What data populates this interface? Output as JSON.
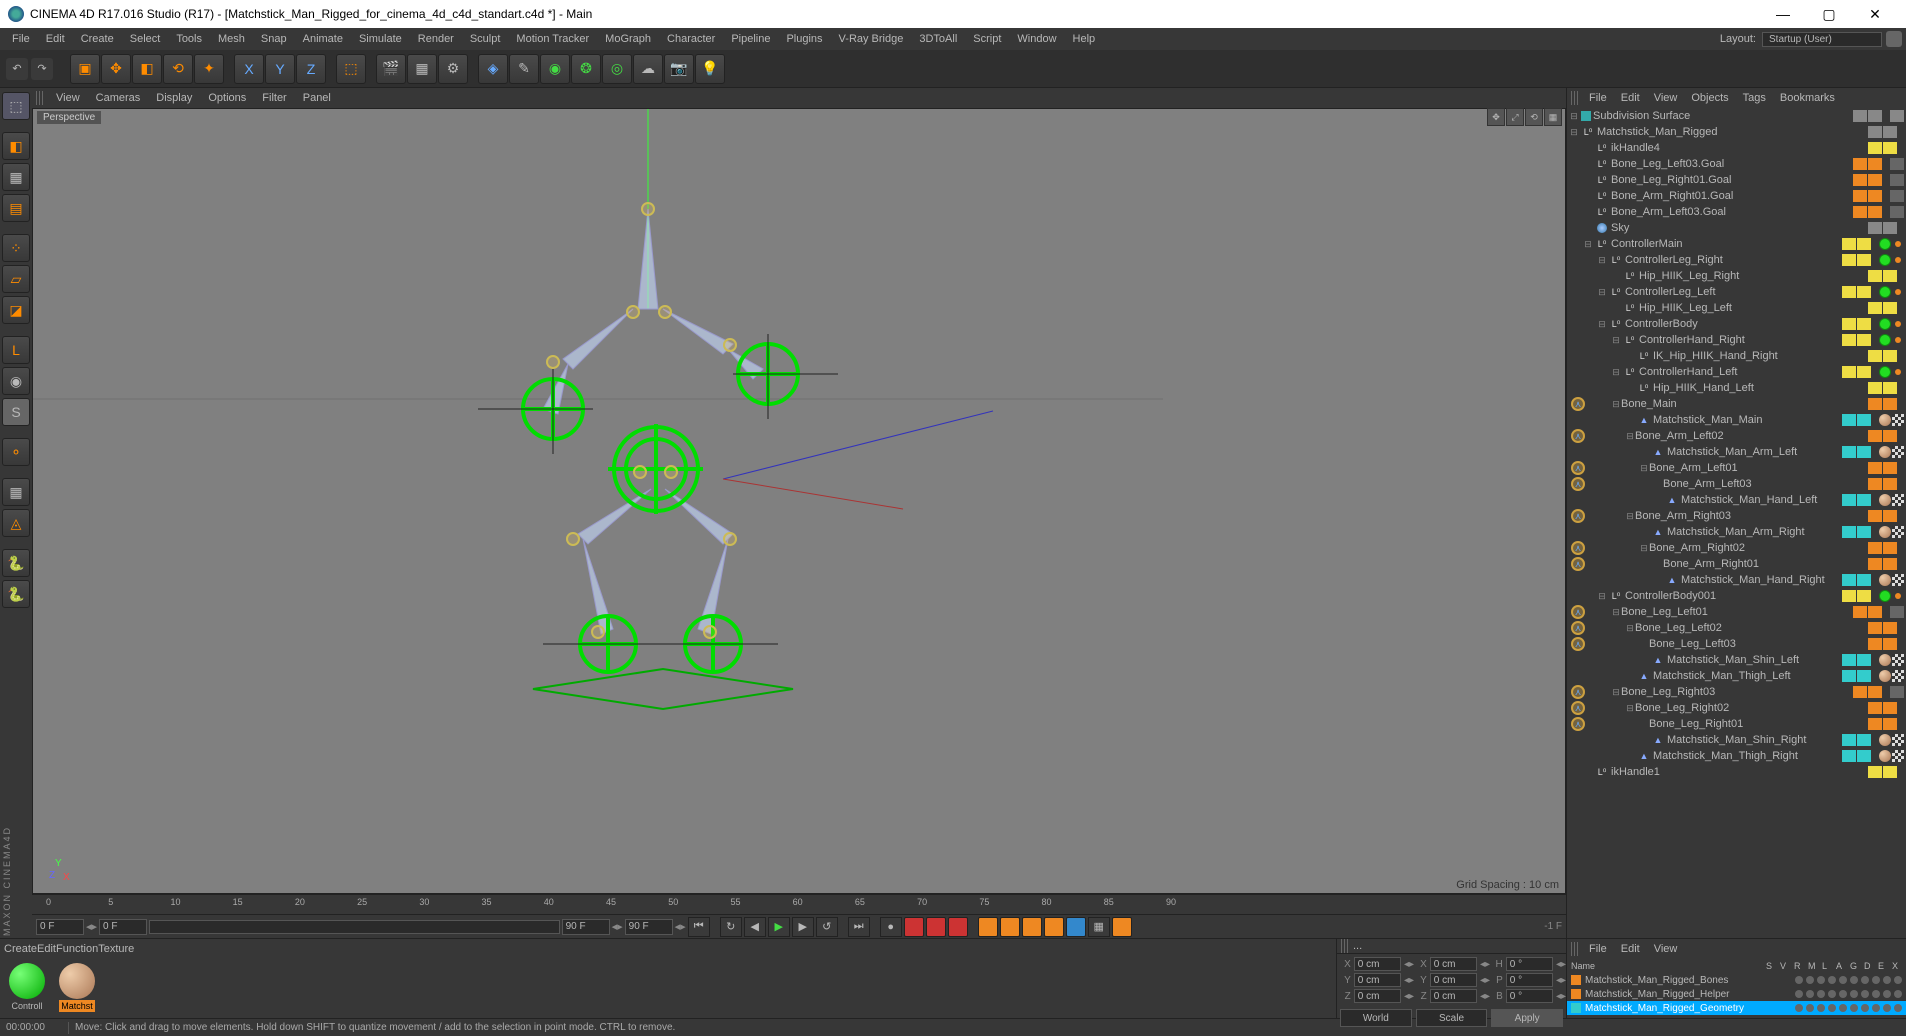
{
  "window": {
    "title": "CINEMA 4D R17.016 Studio (R17) - [Matchstick_Man_Rigged_for_cinema_4d_c4d_standart.c4d *] - Main"
  },
  "menubar": [
    "File",
    "Edit",
    "Create",
    "Select",
    "Tools",
    "Mesh",
    "Snap",
    "Animate",
    "Simulate",
    "Render",
    "Sculpt",
    "Motion Tracker",
    "MoGraph",
    "Character",
    "Pipeline",
    "Plugins",
    "V-Ray Bridge",
    "3DToAll",
    "Script",
    "Window",
    "Help"
  ],
  "layout": {
    "label": "Layout:",
    "value": "Startup (User)"
  },
  "viewport_menubar": [
    "View",
    "Cameras",
    "Display",
    "Options",
    "Filter",
    "Panel"
  ],
  "viewport": {
    "label": "Perspective",
    "grid": "Grid Spacing : 10 cm"
  },
  "ruler": {
    "ticks": [
      0,
      5,
      10,
      15,
      20,
      25,
      30,
      35,
      40,
      45,
      50,
      55,
      60,
      65,
      70,
      75,
      80,
      85,
      90
    ]
  },
  "timeline": {
    "startF": "0 F",
    "startF2": "0 F",
    "endF": "90 F",
    "endF2": "90 F",
    "suffix": "-1 F"
  },
  "object_manager_menu": [
    "File",
    "Edit",
    "View",
    "Objects",
    "Tags",
    "Bookmarks"
  ],
  "tree": [
    {
      "d": 0,
      "e": "-",
      "icon": "subdiv",
      "name": "Subdivision Surface",
      "vis": "gray",
      "tags": [
        "check"
      ]
    },
    {
      "d": 0,
      "e": "-",
      "icon": "null",
      "name": "Matchstick_Man_Rigged",
      "vis": "gray",
      "tags": []
    },
    {
      "d": 1,
      "e": "",
      "icon": "null",
      "name": "ikHandle4",
      "vis": "yellow",
      "tags": []
    },
    {
      "d": 1,
      "e": "",
      "icon": "null",
      "name": "Bone_Leg_Left03.Goal",
      "vis": "orange",
      "tags": [
        "const"
      ]
    },
    {
      "d": 1,
      "e": "",
      "icon": "null",
      "name": "Bone_Leg_Right01.Goal",
      "vis": "orange",
      "tags": [
        "const"
      ]
    },
    {
      "d": 1,
      "e": "",
      "icon": "null",
      "name": "Bone_Arm_Right01.Goal",
      "vis": "orange",
      "tags": [
        "const"
      ]
    },
    {
      "d": 1,
      "e": "",
      "icon": "null",
      "name": "Bone_Arm_Left03.Goal",
      "vis": "orange",
      "tags": [
        "const"
      ]
    },
    {
      "d": 1,
      "e": "",
      "icon": "sky",
      "name": "Sky",
      "vis": "gray",
      "tags": []
    },
    {
      "d": 1,
      "e": "-",
      "icon": "null",
      "name": "ControllerMain",
      "vis": "yellow",
      "tags": [
        "green",
        "odot"
      ]
    },
    {
      "d": 2,
      "e": "-",
      "icon": "null",
      "name": "ControllerLeg_Right",
      "vis": "yellow",
      "tags": [
        "green",
        "odot"
      ]
    },
    {
      "d": 3,
      "e": "",
      "icon": "null",
      "name": "Hip_HIIK_Leg_Right",
      "vis": "yellow",
      "tags": []
    },
    {
      "d": 2,
      "e": "-",
      "icon": "null",
      "name": "ControllerLeg_Left",
      "vis": "yellow",
      "tags": [
        "green",
        "odot"
      ]
    },
    {
      "d": 3,
      "e": "",
      "icon": "null",
      "name": "Hip_HIIK_Leg_Left",
      "vis": "yellow",
      "tags": []
    },
    {
      "d": 2,
      "e": "-",
      "icon": "null",
      "name": "ControllerBody",
      "vis": "yellow",
      "tags": [
        "green",
        "odot"
      ]
    },
    {
      "d": 3,
      "e": "-",
      "icon": "null",
      "name": "ControllerHand_Right",
      "vis": "yellow",
      "tags": [
        "green",
        "odot"
      ]
    },
    {
      "d": 4,
      "e": "",
      "icon": "null",
      "name": "IK_Hip_HIIK_Hand_Right",
      "vis": "yellow",
      "tags": []
    },
    {
      "d": 3,
      "e": "-",
      "icon": "null",
      "name": "ControllerHand_Left",
      "vis": "yellow",
      "tags": [
        "green",
        "odot"
      ]
    },
    {
      "d": 4,
      "e": "",
      "icon": "null",
      "name": "Hip_HIIK_Hand_Left",
      "vis": "yellow",
      "tags": []
    },
    {
      "d": 3,
      "e": "-",
      "icon": "joint",
      "name": "Bone_Main",
      "vis": "orange",
      "tags": []
    },
    {
      "d": 4,
      "e": "",
      "icon": "mesh",
      "name": "Matchstick_Man_Main",
      "vis": "cyan",
      "tags": [
        "sphere",
        "checker"
      ]
    },
    {
      "d": 4,
      "e": "-",
      "icon": "joint",
      "name": "Bone_Arm_Left02",
      "vis": "orange",
      "tags": []
    },
    {
      "d": 5,
      "e": "",
      "icon": "mesh",
      "name": "Matchstick_Man_Arm_Left",
      "vis": "cyan",
      "tags": [
        "sphere",
        "checker"
      ]
    },
    {
      "d": 5,
      "e": "-",
      "icon": "joint",
      "name": "Bone_Arm_Left01",
      "vis": "orange",
      "tags": []
    },
    {
      "d": 6,
      "e": "",
      "icon": "joint",
      "name": "Bone_Arm_Left03",
      "vis": "orange",
      "tags": []
    },
    {
      "d": 6,
      "e": "",
      "icon": "mesh",
      "name": "Matchstick_Man_Hand_Left",
      "vis": "cyan",
      "tags": [
        "sphere",
        "checker"
      ]
    },
    {
      "d": 4,
      "e": "-",
      "icon": "joint",
      "name": "Bone_Arm_Right03",
      "vis": "orange",
      "tags": []
    },
    {
      "d": 5,
      "e": "",
      "icon": "mesh",
      "name": "Matchstick_Man_Arm_Right",
      "vis": "cyan",
      "tags": [
        "sphere",
        "checker"
      ]
    },
    {
      "d": 5,
      "e": "-",
      "icon": "joint",
      "name": "Bone_Arm_Right02",
      "vis": "orange",
      "tags": []
    },
    {
      "d": 6,
      "e": "",
      "icon": "joint",
      "name": "Bone_Arm_Right01",
      "vis": "orange",
      "tags": []
    },
    {
      "d": 6,
      "e": "",
      "icon": "mesh",
      "name": "Matchstick_Man_Hand_Right",
      "vis": "cyan",
      "tags": [
        "sphere",
        "checker"
      ]
    },
    {
      "d": 2,
      "e": "-",
      "icon": "null",
      "name": "ControllerBody001",
      "vis": "yellow",
      "tags": [
        "green",
        "odot"
      ]
    },
    {
      "d": 3,
      "e": "-",
      "icon": "joint",
      "name": "Bone_Leg_Left01",
      "vis": "orange",
      "tags": [
        "const"
      ]
    },
    {
      "d": 4,
      "e": "-",
      "icon": "joint",
      "name": "Bone_Leg_Left02",
      "vis": "orange",
      "tags": []
    },
    {
      "d": 5,
      "e": "",
      "icon": "joint",
      "name": "Bone_Leg_Left03",
      "vis": "orange",
      "tags": []
    },
    {
      "d": 5,
      "e": "",
      "icon": "mesh",
      "name": "Matchstick_Man_Shin_Left",
      "vis": "cyan",
      "tags": [
        "sphere",
        "checker"
      ]
    },
    {
      "d": 4,
      "e": "",
      "icon": "mesh",
      "name": "Matchstick_Man_Thigh_Left",
      "vis": "cyan",
      "tags": [
        "sphere",
        "checker"
      ]
    },
    {
      "d": 3,
      "e": "-",
      "icon": "joint",
      "name": "Bone_Leg_Right03",
      "vis": "orange",
      "tags": [
        "const"
      ]
    },
    {
      "d": 4,
      "e": "-",
      "icon": "joint",
      "name": "Bone_Leg_Right02",
      "vis": "orange",
      "tags": []
    },
    {
      "d": 5,
      "e": "",
      "icon": "joint",
      "name": "Bone_Leg_Right01",
      "vis": "orange",
      "tags": []
    },
    {
      "d": 5,
      "e": "",
      "icon": "mesh",
      "name": "Matchstick_Man_Shin_Right",
      "vis": "cyan",
      "tags": [
        "sphere",
        "checker"
      ]
    },
    {
      "d": 4,
      "e": "",
      "icon": "mesh",
      "name": "Matchstick_Man_Thigh_Right",
      "vis": "cyan",
      "tags": [
        "sphere",
        "checker"
      ]
    },
    {
      "d": 1,
      "e": "",
      "icon": "null",
      "name": "ikHandle1",
      "vis": "yellow",
      "tags": []
    }
  ],
  "materials_menu": [
    "Create",
    "Edit",
    "Function",
    "Texture"
  ],
  "materials": [
    {
      "name": "Controll",
      "color": "radial-gradient(circle at 30% 30%,#7f7,#0a0)",
      "active": false
    },
    {
      "name": "Matchst",
      "color": "radial-gradient(circle at 30% 30%,#eca,#a75)",
      "active": true
    }
  ],
  "attrs_menu": "...",
  "coords": {
    "X": "0 cm",
    "Y": "0 cm",
    "Z": "0 cm",
    "X2": "0 cm",
    "Y2": "0 cm",
    "Z2": "0 cm",
    "H": "0 °",
    "P": "0 °",
    "B": "0 °",
    "world": "World",
    "scale": "Scale",
    "apply": "Apply"
  },
  "layers_menu": [
    "File",
    "Edit",
    "View"
  ],
  "layers_cols": [
    "Name",
    "S",
    "V",
    "R",
    "M",
    "L",
    "A",
    "G",
    "D",
    "E",
    "X"
  ],
  "layers": [
    {
      "name": "Matchstick_Man_Rigged_Bones",
      "color": "#e82",
      "active": false
    },
    {
      "name": "Matchstick_Man_Rigged_Helper",
      "color": "#e82",
      "active": false
    },
    {
      "name": "Matchstick_Man_Rigged_Geometry",
      "color": "#3cc",
      "active": true
    }
  ],
  "status": {
    "time": "00:00:00",
    "msg": "Move: Click and drag to move elements. Hold down SHIFT to quantize movement / add to the selection in point mode. CTRL to remove."
  },
  "brand": "MAXON CINEMA4D"
}
